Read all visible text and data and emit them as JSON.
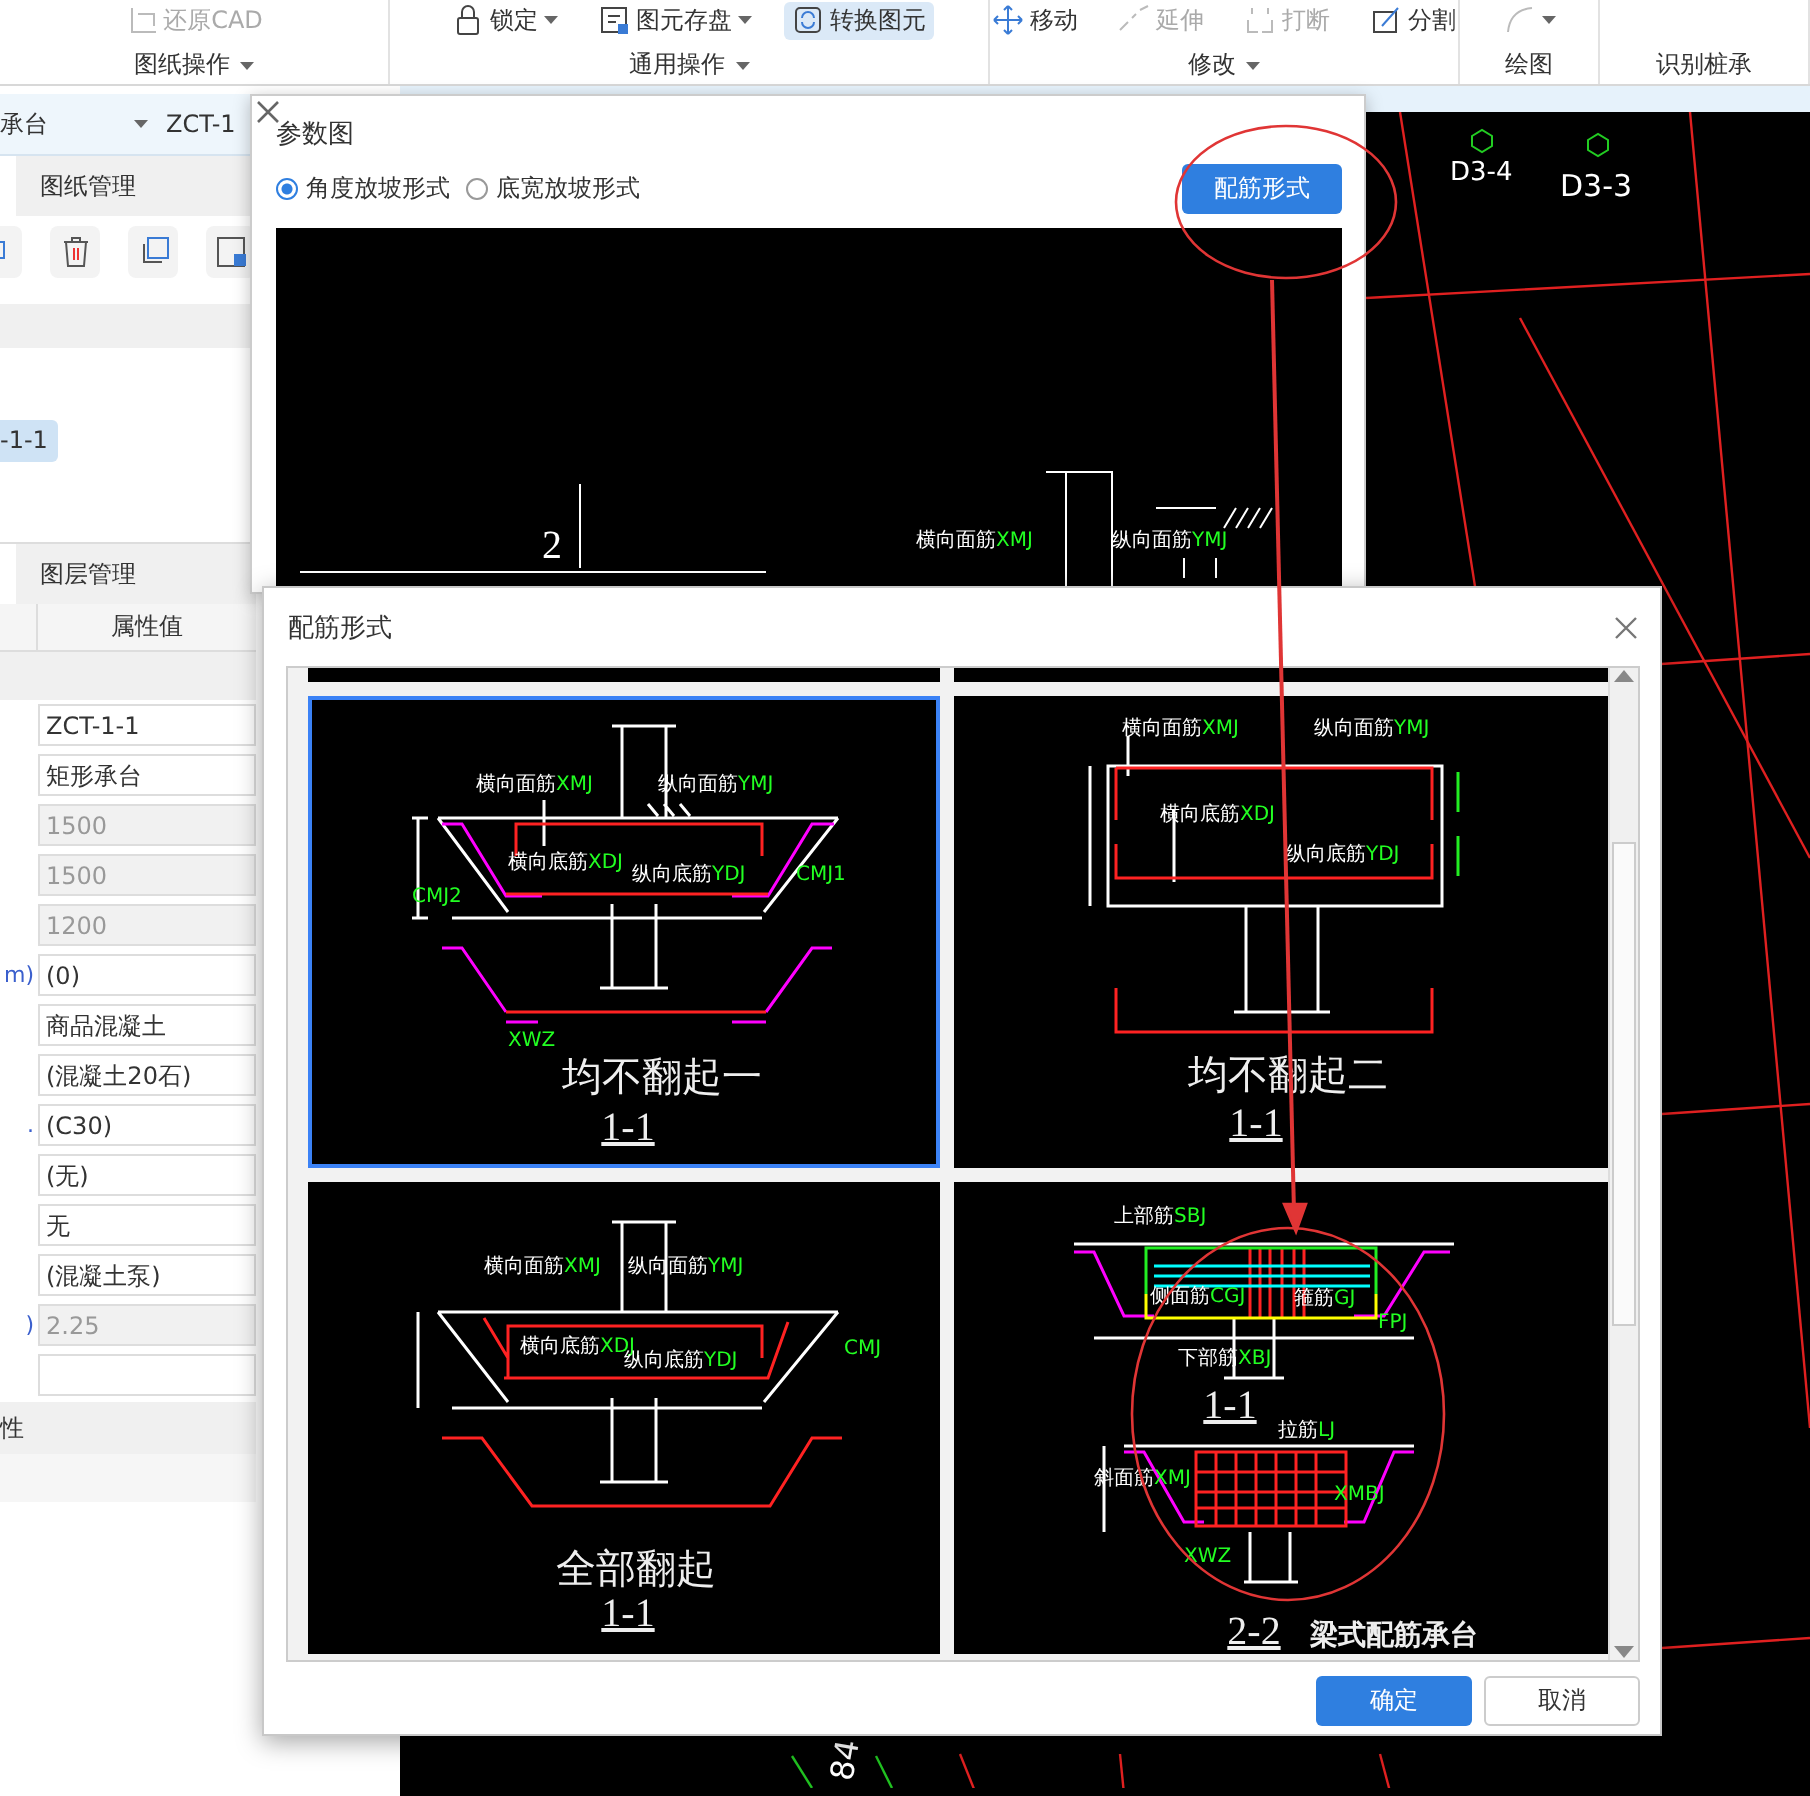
{
  "ribbon": {
    "groups": [
      {
        "label": "图纸操作",
        "menu": true,
        "tools": [
          {
            "label": "还原CAD",
            "kind": "restore",
            "disabled": true,
            "selected": false,
            "dropdown": false
          }
        ]
      },
      {
        "label": "通用操作",
        "menu": true,
        "tools": [
          {
            "label": "锁定",
            "kind": "lock",
            "disabled": false,
            "selected": false,
            "dropdown": true
          },
          {
            "label": "图元存盘",
            "kind": "store",
            "disabled": false,
            "selected": false,
            "dropdown": true
          },
          {
            "label": "转换图元",
            "kind": "convert",
            "disabled": false,
            "selected": true,
            "dropdown": false
          }
        ]
      },
      {
        "label": "修改",
        "menu": true,
        "tools": [
          {
            "label": "移动",
            "kind": "move",
            "disabled": false,
            "selected": false,
            "dropdown": false
          },
          {
            "label": "延伸",
            "kind": "extend",
            "disabled": true,
            "selected": false,
            "dropdown": false
          },
          {
            "label": "打断",
            "kind": "break",
            "disabled": true,
            "selected": false,
            "dropdown": false
          },
          {
            "label": "分割",
            "kind": "split",
            "disabled": false,
            "selected": false,
            "dropdown": false
          }
        ]
      },
      {
        "label": "绘图",
        "menu": false,
        "tools": [
          {
            "kind": "arc",
            "disabled": true,
            "selected": false,
            "dropdown": true
          }
        ]
      },
      {
        "label": "识别桩承",
        "menu": false
      }
    ]
  },
  "left_panel": {
    "selector": {
      "type": "承台",
      "name": "ZCT-1"
    },
    "drawing_tab": "图纸管理",
    "list_items": [
      {
        "label": "-1-1",
        "selected": true
      }
    ],
    "layer_tab": "图层管理",
    "property_table": {
      "column": "属性值",
      "rows": [
        {
          "value": "ZCT-1-1",
          "disabled": false
        },
        {
          "value": "矩形承台",
          "disabled": false
        },
        {
          "value": "1500",
          "disabled": true
        },
        {
          "value": "1500",
          "disabled": true
        },
        {
          "value": "1200",
          "disabled": true
        },
        {
          "label": "m)",
          "value": "(0)",
          "disabled": false
        },
        {
          "value": "商品混凝土",
          "disabled": false
        },
        {
          "value": "(混凝土20石)",
          "disabled": false
        },
        {
          "label": ".",
          "value": "(C30)",
          "disabled": false
        },
        {
          "value": "(无)",
          "disabled": false
        },
        {
          "value": "无",
          "disabled": false
        },
        {
          "value": "(混凝土泵)",
          "disabled": false
        },
        {
          "label": ")",
          "value": "2.25",
          "disabled": true
        },
        {
          "disabled": false
        }
      ]
    },
    "section": "性"
  },
  "cad": {
    "labels": [
      "D3-4",
      "D3-3",
      "84"
    ]
  },
  "param_dialog": {
    "title": "参数图",
    "options": [
      {
        "label": "角度放坡形式",
        "selected": true
      },
      {
        "label": "底宽放坡形式",
        "selected": false
      }
    ],
    "button": "配筋形式",
    "preview": {
      "number": "2",
      "labels": [
        {
          "text": "横向面筋",
          "code": "XMJ"
        },
        {
          "text": "纵向面筋",
          "code": "YMJ"
        }
      ]
    }
  },
  "rebar_dialog": {
    "title": "配筋形式",
    "options": [
      {
        "kind": "flat-one",
        "selected": true,
        "caption": "均不翻起一",
        "section": "1-1",
        "labels": [
          {
            "text": "横向面筋",
            "code": "XMJ"
          },
          {
            "text": "纵向面筋",
            "code": "YMJ"
          },
          {
            "text": "横向底筋",
            "code": "XDJ"
          },
          {
            "text": "纵向底筋",
            "code": "YDJ"
          },
          {
            "code": "CMJ1"
          },
          {
            "code": "CMJ2"
          },
          {
            "code": "XWZ"
          }
        ]
      },
      {
        "kind": "flat-two",
        "selected": false,
        "caption": "均不翻起二",
        "section": "1-1",
        "labels": [
          {
            "text": "横向面筋",
            "code": "XMJ"
          },
          {
            "text": "纵向面筋",
            "code": "YMJ"
          },
          {
            "text": "横向底筋",
            "code": "XDJ"
          },
          {
            "text": "纵向底筋",
            "code": "YDJ"
          }
        ]
      },
      {
        "kind": "all-up",
        "selected": false,
        "caption": "全部翻起",
        "section": "1-1",
        "labels": [
          {
            "text": "横向面筋",
            "code": "XMJ"
          },
          {
            "text": "纵向面筋",
            "code": "YMJ"
          },
          {
            "text": "横向底筋",
            "code": "XDJ"
          },
          {
            "text": "纵向底筋",
            "code": "YDJ"
          },
          {
            "code": "CMJ"
          }
        ]
      },
      {
        "kind": "beam",
        "selected": false,
        "caption": "梁式配筋承台",
        "section": "2-2",
        "section_top": "1-1",
        "labels": [
          {
            "text": "上部筋",
            "code": "SBJ"
          },
          {
            "text": "侧面筋",
            "code": "CGJ"
          },
          {
            "text": "箍筋",
            "code": "GJ"
          },
          {
            "code": "FPJ"
          },
          {
            "text": "下部筋",
            "code": "XBJ"
          },
          {
            "text": "拉筋",
            "code": "LJ"
          },
          {
            "text": "斜面筋",
            "code": "XMJ"
          },
          {
            "code": "XMBJ"
          },
          {
            "code": "XWZ"
          }
        ]
      }
    ],
    "buttons": [
      {
        "label": "确定",
        "kind": "primary"
      },
      {
        "label": "取消",
        "kind": "secondary"
      }
    ]
  }
}
